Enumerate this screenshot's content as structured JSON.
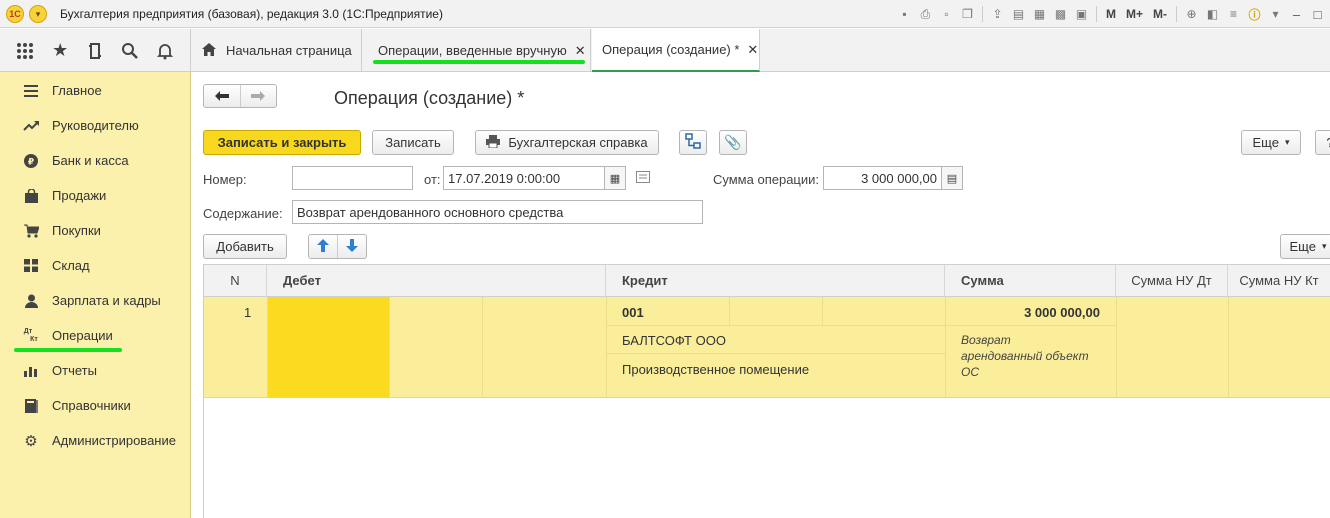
{
  "window": {
    "title": "Бухгалтерия предприятия (базовая), редакция 3.0  (1С:Предприятие)",
    "logo_text": "1С",
    "toolbar_text": {
      "m": "M",
      "mplus": "M+",
      "mminus": "M-"
    }
  },
  "tabs": [
    {
      "label": "Начальная страница",
      "closable": false
    },
    {
      "label": "Операции, введенные вручную",
      "closable": true
    },
    {
      "label": "Операция (создание) *",
      "closable": true,
      "active": true
    }
  ],
  "sidebar": {
    "items": [
      {
        "label": "Главное",
        "icon": "menu-lines-icon"
      },
      {
        "label": "Руководителю",
        "icon": "trend-up-icon"
      },
      {
        "label": "Банк и касса",
        "icon": "ruble-coin-icon"
      },
      {
        "label": "Продажи",
        "icon": "shopping-bag-icon"
      },
      {
        "label": "Покупки",
        "icon": "cart-icon"
      },
      {
        "label": "Склад",
        "icon": "warehouse-grid-icon"
      },
      {
        "label": "Зарплата и кадры",
        "icon": "person-icon"
      },
      {
        "label": "Операции",
        "icon": "debit-credit-icon",
        "icon_text_top": "Дт",
        "icon_text_bottom": "Кт"
      },
      {
        "label": "Отчеты",
        "icon": "bar-chart-icon"
      },
      {
        "label": "Справочники",
        "icon": "book-icon"
      },
      {
        "label": "Администрирование",
        "icon": "gear-icon"
      }
    ]
  },
  "form": {
    "title": "Операция (создание) *",
    "buttons": {
      "save_close": "Записать и закрыть",
      "save": "Записать",
      "report": "Бухгалтерская справка",
      "more": "Еще",
      "help": "?"
    },
    "number_label": "Номер:",
    "number_value": "",
    "date_label": "от:",
    "date_value": "17.07.2019  0:00:00",
    "amount_label": "Сумма операции:",
    "amount_value": "3 000 000,00",
    "content_label": "Содержание:",
    "content_value": "Возврат арендованного основного средства",
    "table_toolbar": {
      "add": "Добавить",
      "more": "Еще"
    }
  },
  "table": {
    "columns": [
      "N",
      "Дебет",
      "Кредит",
      "Сумма",
      "Сумма НУ Дт",
      "Сумма НУ Кт"
    ],
    "rows": [
      {
        "n": "1",
        "credit_account": "001",
        "credit_subconto1": "БАЛТСОФТ ООО",
        "credit_subconto2": "Производственное помещение",
        "amount": "3 000 000,00",
        "description": [
          "Возврат",
          "арендованный объект",
          "ОС"
        ]
      }
    ]
  },
  "colors": {
    "sidebar_bg": "#fbf0ac",
    "primary_button": "#f8d81c",
    "row_highlight": "#faee9b",
    "empty_cell": "#fadb20",
    "annotation": "#14e01e"
  }
}
